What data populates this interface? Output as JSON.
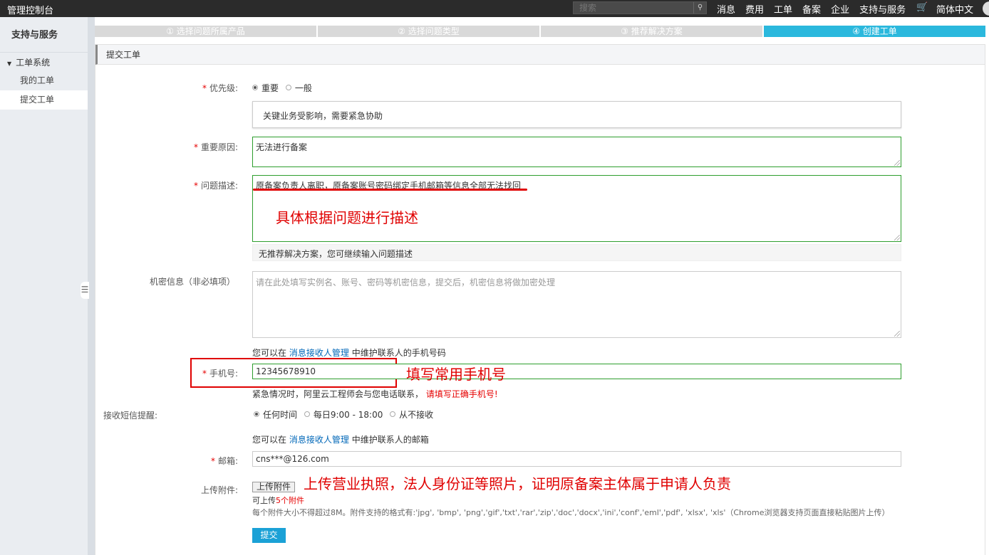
{
  "topbar": {
    "brand": "管理控制台",
    "search_placeholder": "搜索",
    "nav": [
      "消息",
      "费用",
      "工单",
      "备案",
      "企业",
      "支持与服务"
    ],
    "cart_icon": "cart-icon",
    "lang": "简体中文"
  },
  "sidebar": {
    "title": "支持与服务",
    "group": "工单系统",
    "items": [
      "我的工单",
      "提交工单"
    ],
    "active_item": "提交工单"
  },
  "steps": [
    {
      "icon": "①",
      "label": "选择问题所属产品"
    },
    {
      "icon": "②",
      "label": "选择问题类型"
    },
    {
      "icon": "③",
      "label": "推荐解决方案"
    },
    {
      "icon": "④",
      "label": "创建工单"
    }
  ],
  "active_step": 4,
  "panel": {
    "title": "提交工单"
  },
  "form": {
    "priority": {
      "label": "优先级:",
      "options": [
        "重要",
        "一般"
      ],
      "selected": "重要",
      "hint": "关键业务受影响，需要紧急协助"
    },
    "reason": {
      "label": "重要原因:",
      "value": "无法进行备案"
    },
    "description": {
      "label": "问题描述:",
      "value": "原备案负责人离职，原备案账号密码绑定手机邮箱等信息全部无法找回",
      "recommend": "无推荐解决方案，您可继续输入问题描述"
    },
    "secret": {
      "label": "机密信息（非必填项）",
      "placeholder": "请在此处填写实例名、账号、密码等机密信息，提交后，机密信息将做加密处理"
    },
    "phone": {
      "pre_note_a": "您可以在",
      "pre_note_link": "消息接收人管理",
      "pre_note_b": "中维护联系人的手机号码",
      "label": "手机号:",
      "value": "12345678910",
      "post_note_a": "紧急情况时，阿里云工程师会与您电话联系，",
      "post_note_red": "请填写正确手机号",
      "post_note_b": "!"
    },
    "sms": {
      "label": "接收短信提醒:",
      "options": [
        "任何时间",
        "每日9:00 - 18:00",
        "从不接收"
      ],
      "selected": "任何时间"
    },
    "email": {
      "pre_note_a": "您可以在",
      "pre_note_link": "消息接收人管理",
      "pre_note_b": "中维护联系人的邮箱",
      "label": "邮箱:",
      "value": "cns***@126.com"
    },
    "upload": {
      "label": "上传附件:",
      "button": "上传附件",
      "limit_a": "可上传",
      "limit_red": "5个附件",
      "rules": "每个附件大小不得超过8M。附件支持的格式有:'jpg', 'bmp', 'png','gif','txt','rar','zip','doc','docx','ini','conf','eml','pdf', 'xlsx', 'xls'（Chrome浏览器支持页面直接粘贴图片上传）"
    },
    "submit": "提交"
  },
  "annotations": {
    "description": "具体根据问题进行描述",
    "phone": "填写常用手机号",
    "upload": "上传营业执照，法人身份证等照片，证明原备案主体属于申请人负责"
  },
  "colors": {
    "accent": "#2bb8dd",
    "annotation_red": "#e00000",
    "field_valid_border": "#2e9e2e",
    "link": "#0067b8"
  }
}
